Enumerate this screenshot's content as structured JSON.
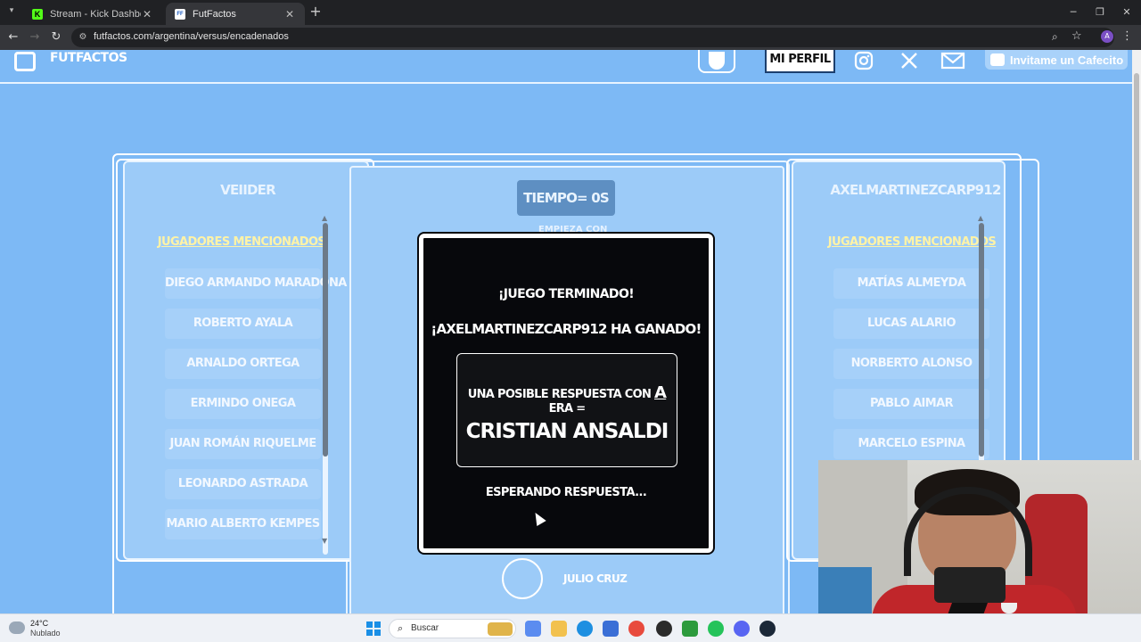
{
  "browser": {
    "tabs": [
      {
        "label": "Stream - Kick Dashboard",
        "favicon": "K",
        "active": false
      },
      {
        "label": "FutFactos",
        "favicon": "FF",
        "active": true
      }
    ],
    "url": "futfactos.com/argentina/versus/encadenados"
  },
  "site": {
    "logo_text": "FUTFACTOS",
    "profile_button": "MI PERFIL",
    "cafecito_button": "Invitame un Cafecito",
    "social": [
      "instagram-icon",
      "x-icon",
      "mail-icon"
    ]
  },
  "game": {
    "timer": "TIEMPO= 0S",
    "hidden_label": "EMPIEZA CON",
    "left_player": {
      "name": "VEIIDER",
      "list_header": "JUGADORES MENCIONADOS",
      "players": [
        "DIEGO ARMANDO MARADONA",
        "ROBERTO AYALA",
        "ARNALDO ORTEGA",
        "ERMINDO ONEGA",
        "JUAN ROMÁN RIQUELME",
        "LEONARDO ASTRADA",
        "MARIO ALBERTO KEMPES"
      ]
    },
    "right_player": {
      "name": "AXELMARTINEZCARP912",
      "list_header": "JUGADORES MENCIONADOS",
      "players": [
        "MATÍAS ALMEYDA",
        "LUCAS ALARIO",
        "NORBERTO ALONSO",
        "PABLO AIMAR",
        "MARCELO ESPINA"
      ]
    },
    "modal": {
      "title": "¡JUEGO TERMINADO!",
      "winner": "¡AXELMARTINEZCARP912 HA GANADO!",
      "answer_prefix": "UNA POSIBLE RESPUESTA CON",
      "answer_letter": "A",
      "answer_suffix": "ERA =",
      "answer_name": "CRISTIAN ANSALDI",
      "waiting": "ESPERANDO RESPUESTA..."
    },
    "hint_player": "JULIO CRUZ"
  },
  "taskbar": {
    "weather_temp": "24°C",
    "weather_desc": "Nublado",
    "search_placeholder": "Buscar"
  },
  "colors": {
    "page_bg": "#7db9f5",
    "modal_bg": "#07080c",
    "highlight_text": "#fff3a6"
  }
}
